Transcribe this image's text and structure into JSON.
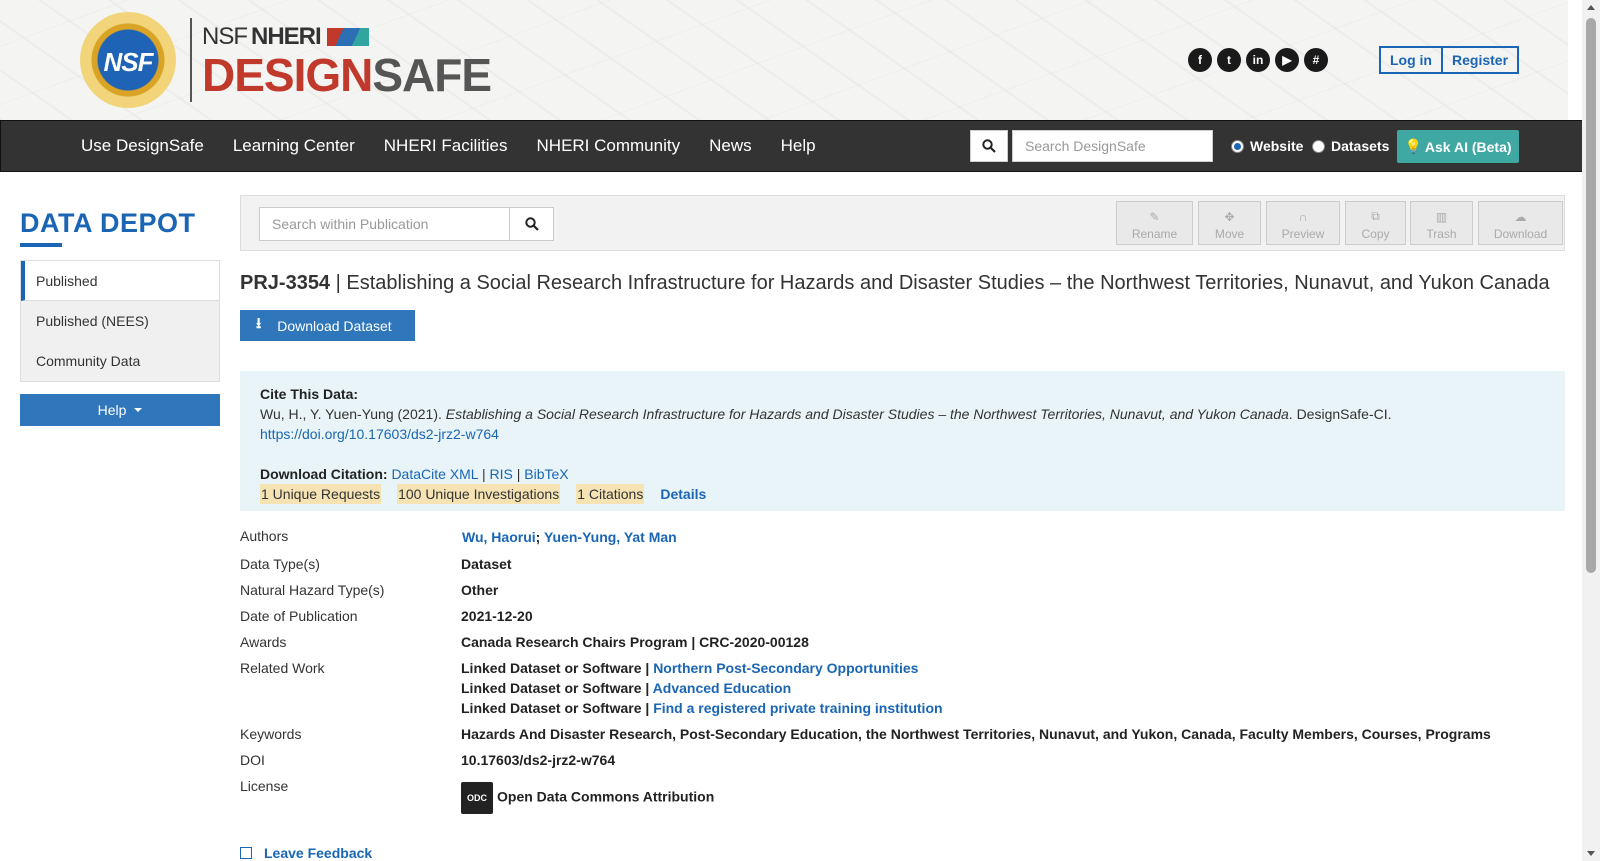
{
  "header": {
    "logo": {
      "seal_text": "NSF",
      "top_prefix": "NSF",
      "top_name": "NHERI",
      "main_design": "DESIGN",
      "main_safe": "SAFE"
    },
    "social_icons": [
      "facebook-icon",
      "twitter-icon",
      "linkedin-icon",
      "youtube-icon",
      "slack-icon"
    ],
    "auth": {
      "login": "Log in",
      "register": "Register"
    }
  },
  "nav": {
    "items": [
      "Use DesignSafe",
      "Learning Center",
      "NHERI Facilities",
      "NHERI Community",
      "News",
      "Help"
    ],
    "search_placeholder": "Search DesignSafe",
    "radio_website": "Website",
    "radio_datasets": "Datasets",
    "ask_ai": "Ask AI (Beta)"
  },
  "sidebar": {
    "title": "DATA DEPOT",
    "items": [
      "Published",
      "Published (NEES)",
      "Community Data"
    ],
    "help": "Help"
  },
  "toolbar": {
    "search_placeholder": "Search within Publication",
    "buttons": [
      "Rename",
      "Move",
      "Preview",
      "Copy",
      "Trash",
      "Download"
    ]
  },
  "publication": {
    "id": "PRJ-3354",
    "separator": " | ",
    "title": "Establishing a Social Research Infrastructure for Hazards and Disaster Studies – the Northwest Territories, Nunavut, and Yukon Canada",
    "download_button": "Download Dataset"
  },
  "citation": {
    "label": "Cite This Data:",
    "authors_year": "Wu, H., Y. Yuen-Yung (2021). ",
    "title": "Establishing a Social Research Infrastructure for Hazards and Disaster Studies – the Northwest Territories, Nunavut, and Yukon Canada",
    "publisher": ". DesignSafe-CI.",
    "doi_url": "https://doi.org/10.17603/ds2-jrz2-w764",
    "download_label": "Download Citation:",
    "formats": [
      "DataCite XML",
      "RIS",
      "BibTeX"
    ],
    "format_separator": " | ",
    "metrics": [
      "1 Unique Requests",
      "100 Unique Investigations",
      "1 Citations"
    ],
    "details": "Details"
  },
  "metadata": {
    "authors_label": "Authors",
    "authors": [
      "Wu, Haorui",
      "Yuen-Yung, Yat Man"
    ],
    "data_type_label": "Data Type(s)",
    "data_type": "Dataset",
    "hazard_label": "Natural Hazard Type(s)",
    "hazard": "Other",
    "date_label": "Date of Publication",
    "date": "2021-12-20",
    "awards_label": "Awards",
    "awards": "Canada Research Chairs Program | CRC-2020-00128",
    "related_label": "Related Work",
    "related": [
      {
        "prefix": "Linked Dataset or Software | ",
        "link": "Northern Post-Secondary Opportunities"
      },
      {
        "prefix": "Linked Dataset or Software | ",
        "link": "Advanced Education"
      },
      {
        "prefix": "Linked Dataset or Software | ",
        "link": "Find a registered private training institution"
      }
    ],
    "keywords_label": "Keywords",
    "keywords": "Hazards And Disaster Research, Post-Secondary Education, the Northwest Territories, Nunavut, and Yukon, Canada, Faculty Members, Courses, Programs",
    "doi_label": "DOI",
    "doi": "10.17603/ds2-jrz2-w764",
    "license_label": "License",
    "license_icon_text": "ODC",
    "license": "Open Data Commons Attribution"
  },
  "feedback": "Leave Feedback",
  "colors": {
    "primary": "#1a66b5",
    "nav_bg": "#333333",
    "ask_ai": "#40a8a2",
    "cite_bg": "#e8f4f8",
    "metric_bg": "#f5e3b3",
    "logo_red": "#c0392b"
  }
}
